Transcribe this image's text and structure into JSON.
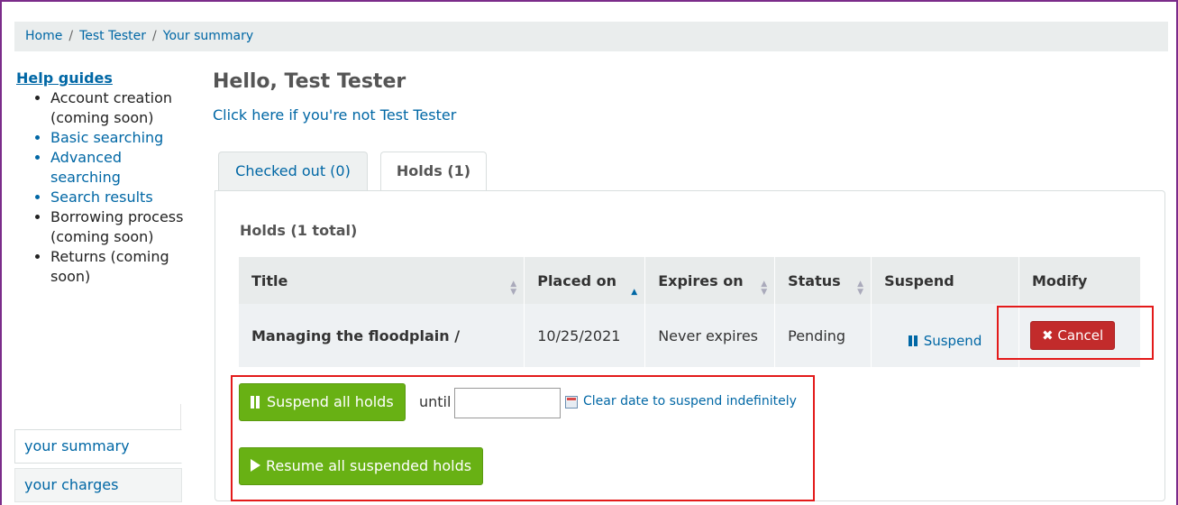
{
  "breadcrumb": {
    "home": "Home",
    "user": "Test Tester",
    "current": "Your summary",
    "separator": "/"
  },
  "sidebar": {
    "help_title": "Help guides",
    "help_items": [
      {
        "label": "Account creation (coming soon)",
        "link": false
      },
      {
        "label": "Basic searching",
        "link": true
      },
      {
        "label": "Advanced searching",
        "link": true
      },
      {
        "label": "Search results",
        "link": true
      },
      {
        "label": "Borrowing process (coming soon)",
        "link": false
      },
      {
        "label": "Returns (coming soon)",
        "link": false
      }
    ],
    "menu": {
      "summary": "your summary",
      "charges": "your charges"
    }
  },
  "main": {
    "greeting": "Hello, Test Tester",
    "not_you": "Click here if you're not Test Tester",
    "tabs": [
      {
        "label": "Checked out (0)",
        "active": false
      },
      {
        "label": "Holds (1)",
        "active": true
      }
    ],
    "holds_heading": "Holds (1 total)",
    "table": {
      "headers": [
        "Title",
        "Placed on",
        "Expires on",
        "Status",
        "Suspend",
        "Modify"
      ],
      "rows": [
        {
          "title": "Managing the floodplain /",
          "placed_on": "10/25/2021",
          "expires_on": "Never expires",
          "status": "Pending",
          "suspend": "Suspend",
          "modify": "Cancel"
        }
      ]
    },
    "suspend_all": "Suspend all holds",
    "until": "until",
    "date_value": "",
    "clear_date": "Clear date to suspend indefinitely",
    "resume_all": "Resume all suspended holds"
  },
  "colors": {
    "link": "#0067a5",
    "green_button": "#68b114",
    "cancel_button": "#c22b2b",
    "highlight_box": "#e31a1a"
  }
}
